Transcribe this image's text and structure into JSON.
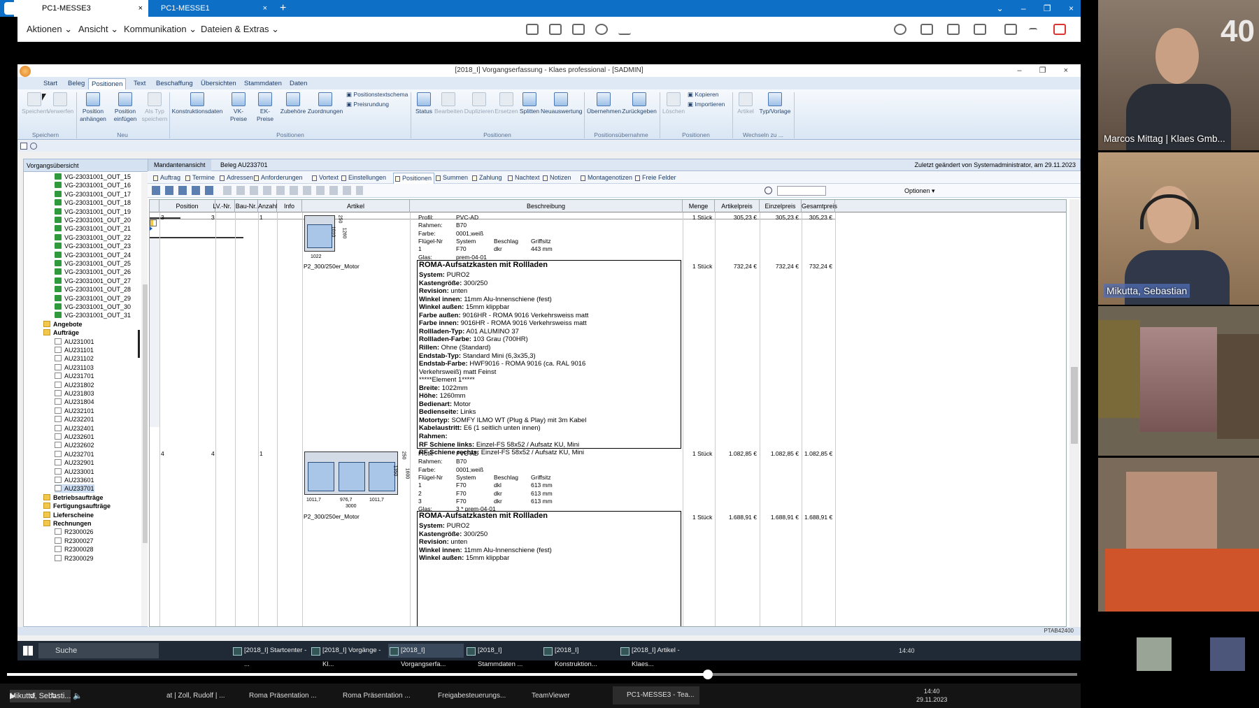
{
  "teamviewer": {
    "tabs": [
      {
        "label": "PC1-MESSE3"
      },
      {
        "label": "PC1-MESSE1"
      }
    ],
    "menu": [
      "Aktionen",
      "Ansicht",
      "Kommunikation",
      "Dateien & Extras"
    ],
    "close_glyph": "×"
  },
  "app": {
    "title": "[2018_I] Vorgangserfassung - Klaes professional - [SADMIN]",
    "ribbon_tabs": [
      "Start",
      "Beleg",
      "Positionen",
      "Text",
      "Beschaffung",
      "Übersichten",
      "Stammdaten",
      "Daten"
    ],
    "ribbon_buttons": {
      "speichern": "Speichern",
      "verwerfen": "Verwerfen",
      "pos_anhaengen": "Position anhängen",
      "pos_einfuegen": "Position einfügen",
      "als_typ": "Als Typ speichern",
      "konstruktion": "Konstruktionsdaten",
      "vk_preise": "VK-Preise",
      "ek_preise": "EK-Preise",
      "zubehoere": "Zubehöre",
      "zuordnungen": "Zuordnungen",
      "positionstextschema": "Positionstextschema",
      "preisrundung": "Preisrundung",
      "status": "Status",
      "bearbeiten": "Bearbeiten",
      "duplizieren": "Duplizieren",
      "ersetzen": "Ersetzen",
      "splitten": "Splitten",
      "neuauswertung": "Neuauswertung",
      "uebernehmen": "Übernehmen",
      "zurueckgeben": "Zurückgeben",
      "loeschen": "Löschen",
      "kopieren": "Kopieren",
      "importieren": "Importieren",
      "artikel": "Artikel",
      "typ_vorlage": "Typ/Vorlage"
    },
    "ribbon_groups": {
      "speichern": "Speichern",
      "neu": "Neu",
      "positionen": "Positionen",
      "positionen2": "Positionen",
      "uebernahme": "Positionsübernahme",
      "positionen3": "Positionen",
      "wechseln": "Wechseln zu ..."
    },
    "left_pane_title": "Vorgangsübersicht",
    "tree": [
      "VG-23031001_OUT_15",
      "VG-23031001_OUT_16",
      "VG-23031001_OUT_17",
      "VG-23031001_OUT_18",
      "VG-23031001_OUT_19",
      "VG-23031001_OUT_20",
      "VG-23031001_OUT_21",
      "VG-23031001_OUT_22",
      "VG-23031001_OUT_23",
      "VG-23031001_OUT_24",
      "VG-23031001_OUT_25",
      "VG-23031001_OUT_26",
      "VG-23031001_OUT_27",
      "VG-23031001_OUT_28",
      "VG-23031001_OUT_29",
      "VG-23031001_OUT_30",
      "VG-23031001_OUT_31"
    ],
    "tree_folders": {
      "angebote": "Angebote",
      "auftraege": "Aufträge",
      "betrieb": "Betriebsaufträge",
      "fertigung": "Fertigungsaufträge",
      "liefer": "Lieferscheine",
      "rechnungen": "Rechnungen"
    },
    "auftraege": [
      "AU231001",
      "AU231101",
      "AU231102",
      "AU231103",
      "AU231701",
      "AU231802",
      "AU231803",
      "AU231804",
      "AU232101",
      "AU232201",
      "AU232401",
      "AU232601",
      "AU232602",
      "AU232701",
      "AU232901",
      "AU233001",
      "AU233601",
      "AU233701"
    ],
    "rechnungen": [
      "R2300026",
      "R2300027",
      "R2300028",
      "R2300029"
    ],
    "main_head": {
      "mandant": "Mandantenansicht",
      "beleg": "Beleg AU233701",
      "changed": "Zuletzt geändert von Systemadministrator, am 29.11.2023"
    },
    "subtabs": [
      "Auftrag",
      "Termine",
      "Adressen",
      "Anforderungen",
      "Vortext",
      "Einstellungen",
      "Positionen",
      "Summen",
      "Zahlung",
      "Nachtext",
      "Notizen",
      "Montagenotizen",
      "Freie Felder"
    ],
    "options_label": "Optionen",
    "grid_headers": [
      "Position",
      "LV.-Nr.",
      "Bau-Nr.",
      "Anzahl",
      "Info",
      "Artikel",
      "Beschreibung",
      "Menge",
      "Artikelpreis",
      "Einzelpreis",
      "Gesamtpreis"
    ],
    "rows": [
      {
        "pos": "3",
        "lv": "3",
        "anzahl": "1",
        "artikel": "P2_300/250er_Motor",
        "dims": {
          "h1": "250",
          "h2": "1010",
          "h3": "1260",
          "w": "1022"
        },
        "spec": [
          [
            "Profil:",
            "PVC-AD"
          ],
          [
            "Rahmen:",
            "B70"
          ],
          [
            "Farbe:",
            "0001,weiß"
          ]
        ],
        "fluegel_header": [
          "Flügel-Nr",
          "System",
          "Beschlag",
          "Griffsitz"
        ],
        "fluegel": [
          [
            "1",
            "F70",
            "dkr",
            "443 mm"
          ]
        ],
        "glas": [
          "Glas:",
          "prem-04-01"
        ],
        "menge": "1 Stück",
        "artikelpreis": "305,23 €",
        "einzelpreis": "305,23 €",
        "gesamtpreis": "305,23 €",
        "sub_menge": "1 Stück",
        "sub_artikelpreis": "732,24 €",
        "sub_einzelpreis": "732,24 €",
        "sub_gesamtpreis": "732,24 €",
        "box_title": "ROMA-Aufsatzkasten mit Rollladen",
        "box_lines": [
          [
            "System:",
            "PURO2"
          ],
          [
            "Kastengröße:",
            "300/250"
          ],
          [
            "Revision:",
            "unten"
          ],
          [
            "Winkel innen:",
            "11mm Alu-Innenschiene (fest)"
          ],
          [
            "Winkel außen:",
            "15mm klippbar"
          ],
          [
            "Farbe außen:",
            "9016HR - ROMA 9016 Verkehrsweiss matt"
          ],
          [
            "Farbe innen:",
            "9016HR - ROMA 9016 Verkehrsweiss matt"
          ],
          [
            "Rollladen-Typ:",
            "A01   ALUMINO 37"
          ],
          [
            "Rollladen-Farbe:",
            "103 Grau (700HR)"
          ],
          [
            "Rillen:",
            "Ohne (Standard)"
          ],
          [
            "Endstab-Typ:",
            "Standard Mini (6,3x35,3)"
          ],
          [
            "Endstab-Farbe:",
            "HWF9016 - ROMA  9016 (ca. RAL 9016"
          ],
          [
            "",
            "Verkehrsweiß) matt Feinst"
          ],
          [
            "",
            "*****Element 1*****"
          ],
          [
            "Breite:",
            "1022mm"
          ],
          [
            "Höhe:",
            "1260mm"
          ],
          [
            "Bedienart:",
            "Motor"
          ],
          [
            "Bedienseite:",
            "Links"
          ],
          [
            "Motortyp:",
            "SOMFY ILMO WT (Plug & Play) mit 3m Kabel"
          ],
          [
            "Kabelaustritt:",
            "E6 (1 seitlich unten innen)"
          ],
          [
            "Rahmen:",
            ""
          ],
          [
            "RF Schiene links:",
            "Einzel-FS 58x52 / Aufsatz KU, Mini"
          ],
          [
            "RF Schiene rechts:",
            "Einzel-FS 58x52 / Aufsatz KU, Mini"
          ]
        ]
      },
      {
        "pos": "4",
        "lv": "4",
        "anzahl": "1",
        "artikel": "P2_300/250er_Motor",
        "dims": {
          "h1": "250",
          "h2": "1350",
          "h3": "1600",
          "w1": "1011,7",
          "w2": "976,7",
          "w3": "1011,7",
          "w": "3000"
        },
        "spec": [
          [
            "Profil:",
            "PVC-AD"
          ],
          [
            "Rahmen:",
            "B70"
          ],
          [
            "Farbe:",
            "0001,weiß"
          ]
        ],
        "fluegel_header": [
          "Flügel-Nr",
          "System",
          "Beschlag",
          "Griffsitz"
        ],
        "fluegel": [
          [
            "1",
            "F70",
            "dkl",
            "613 mm"
          ],
          [
            "2",
            "F70",
            "dkr",
            "613 mm"
          ],
          [
            "3",
            "F70",
            "dkr",
            "613 mm"
          ]
        ],
        "glas": [
          "Glas:",
          "3 * prem-04-01"
        ],
        "menge": "1 Stück",
        "artikelpreis": "1.082,85 €",
        "einzelpreis": "1.082,85 €",
        "gesamtpreis": "1.082,85 €",
        "sub_menge": "1 Stück",
        "sub_artikelpreis": "1.688,91 €",
        "sub_einzelpreis": "1.688,91 €",
        "sub_gesamtpreis": "1.688,91 €",
        "box_title": "ROMA-Aufsatzkasten mit Rollladen",
        "box_lines": [
          [
            "System:",
            "PURO2"
          ],
          [
            "Kastengröße:",
            "300/250"
          ],
          [
            "Revision:",
            "unten"
          ],
          [
            "Winkel innen:",
            "11mm Alu-Innenschiene (fest)"
          ],
          [
            "Winkel außen:",
            "15mm klippbar"
          ]
        ]
      }
    ],
    "status_code": "PTAB42400"
  },
  "windows_taskbar": {
    "search": "Suche",
    "items": [
      "[2018_I] Startcenter - ...",
      "[2018_I] Vorgänge - Kl...",
      "[2018_I] Vorgangserfa...",
      "[2018_I] Stammdaten ...",
      "[2018_I] Konstruktion...",
      "[2018_I] Artikel - Klaes..."
    ],
    "time": "14:40"
  },
  "local_taskbar": {
    "items": [
      "at | Zoll, Rudolf | ...",
      "Roma Präsentation ...",
      "Roma Präsentation ...",
      "Freigabesteuerungs...",
      "TeamViewer",
      "PC1-MESSE3 - Tea..."
    ],
    "time": "14:40",
    "date": "29.11.2023",
    "speed": "1x"
  },
  "video": {
    "participants": [
      {
        "name": "Marcos Mittag | Klaes Gmb..."
      },
      {
        "name": "Mikutta, Sebastian"
      }
    ],
    "caption": "Mikutta, Sebasti...",
    "badge": "40"
  },
  "colors": {
    "tv_blue": "#0e6fc6",
    "ribbon_blue": "#dfe9f5",
    "selection": "#cfdff3"
  }
}
